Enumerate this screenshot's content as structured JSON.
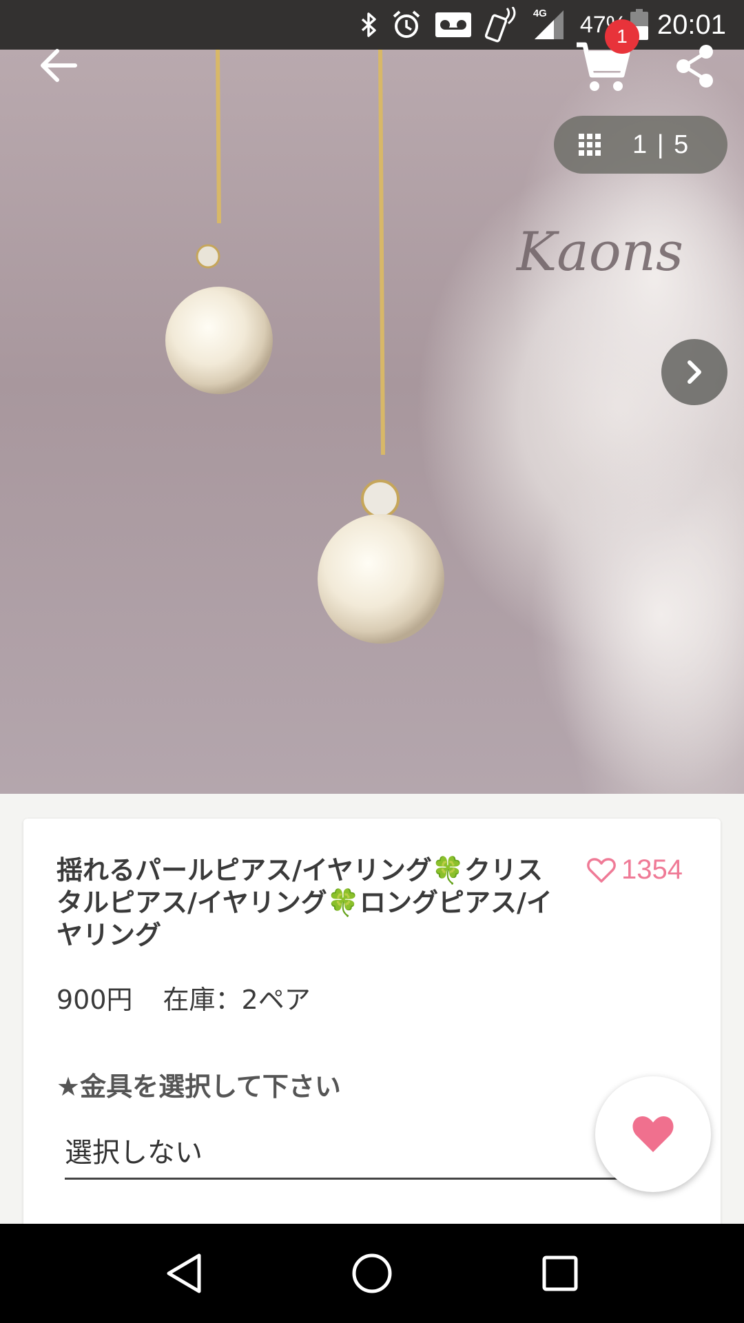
{
  "status_bar": {
    "battery_percent": "47%",
    "time": "20:01",
    "network": "4G",
    "icons": [
      "bluetooth-icon",
      "alarm-icon",
      "voicemail-icon",
      "nfc-icon",
      "signal-icon",
      "battery-icon"
    ]
  },
  "header": {
    "cart_badge": "1",
    "icons": [
      "back-arrow-icon",
      "cart-icon",
      "share-icon"
    ]
  },
  "gallery": {
    "counter": "1 | 5",
    "watermark": "Kaons"
  },
  "product": {
    "title": "揺れるパールピアス/イヤリング🍀クリスタルピアス/イヤリング🍀ロングピアス/イヤリング",
    "like_count": "1354",
    "price": "900円",
    "stock": "在庫：2ペア",
    "option_label": "★金具を選択して下さい",
    "option_value": "選択しない"
  },
  "colors": {
    "accent_pink": "#ef7a96",
    "badge_red": "#e8333a",
    "status_bar_bg": "#333130"
  }
}
